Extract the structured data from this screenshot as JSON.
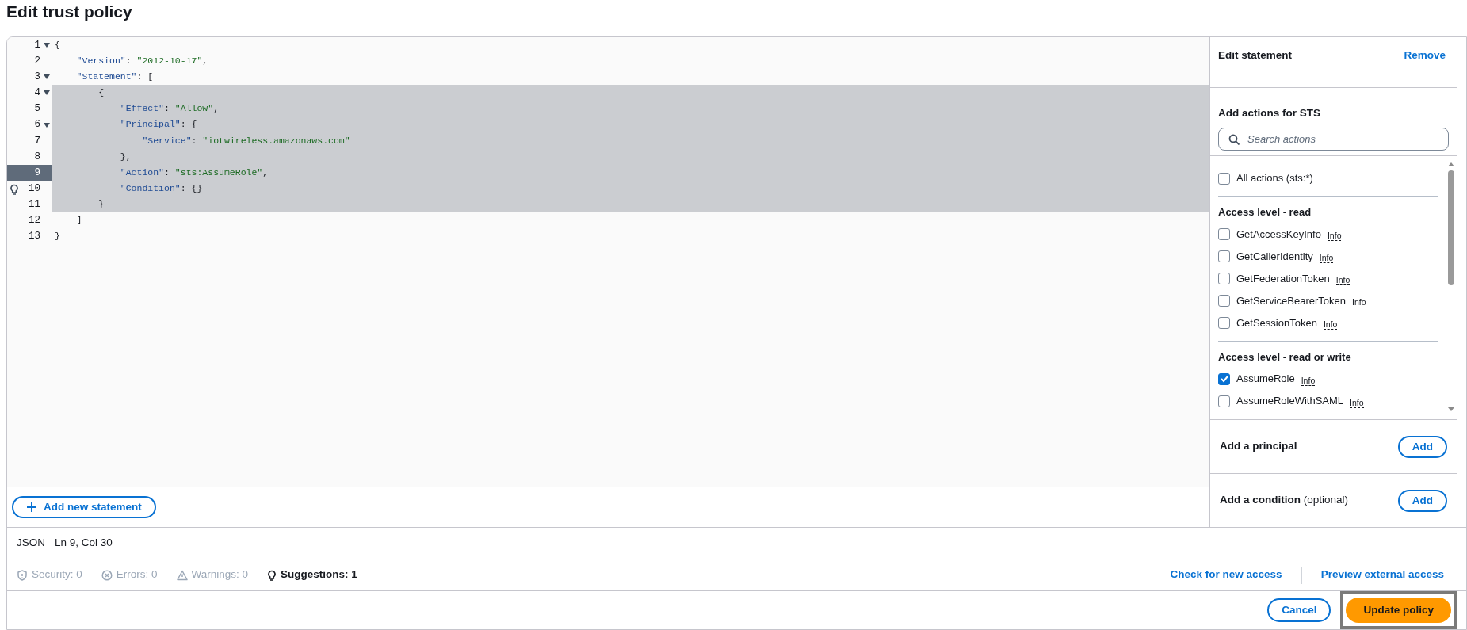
{
  "title": "Edit trust policy",
  "editor": {
    "lines": [
      {
        "number": "1",
        "fold": true,
        "selected": false,
        "current": false,
        "hint": false,
        "tokens": [
          {
            "kind": "punct",
            "text": "{"
          }
        ]
      },
      {
        "number": "2",
        "fold": false,
        "selected": false,
        "current": false,
        "hint": false,
        "tokens": [
          {
            "kind": "key",
            "text": "    \"Version\""
          },
          {
            "kind": "punct",
            "text": ": "
          },
          {
            "kind": "string",
            "text": "\"2012-10-17\""
          },
          {
            "kind": "punct",
            "text": ","
          }
        ]
      },
      {
        "number": "3",
        "fold": true,
        "selected": false,
        "current": false,
        "hint": false,
        "tokens": [
          {
            "kind": "key",
            "text": "    \"Statement\""
          },
          {
            "kind": "punct",
            "text": ": ["
          }
        ]
      },
      {
        "number": "4",
        "fold": true,
        "selected": true,
        "current": false,
        "hint": false,
        "tokens": [
          {
            "kind": "punct",
            "text": "        {"
          }
        ]
      },
      {
        "number": "5",
        "fold": false,
        "selected": true,
        "current": false,
        "hint": false,
        "tokens": [
          {
            "kind": "key",
            "text": "            \"Effect\""
          },
          {
            "kind": "punct",
            "text": ": "
          },
          {
            "kind": "string",
            "text": "\"Allow\""
          },
          {
            "kind": "punct",
            "text": ","
          }
        ]
      },
      {
        "number": "6",
        "fold": true,
        "selected": true,
        "current": false,
        "hint": false,
        "tokens": [
          {
            "kind": "key",
            "text": "            \"Principal\""
          },
          {
            "kind": "punct",
            "text": ": {"
          }
        ]
      },
      {
        "number": "7",
        "fold": false,
        "selected": true,
        "current": false,
        "hint": false,
        "tokens": [
          {
            "kind": "key",
            "text": "                \"Service\""
          },
          {
            "kind": "punct",
            "text": ": "
          },
          {
            "kind": "string",
            "text": "\"iotwireless.amazonaws.com\""
          }
        ]
      },
      {
        "number": "8",
        "fold": false,
        "selected": true,
        "current": false,
        "hint": false,
        "tokens": [
          {
            "kind": "punct",
            "text": "            },"
          }
        ]
      },
      {
        "number": "9",
        "fold": false,
        "selected": true,
        "current": true,
        "hint": false,
        "tokens": [
          {
            "kind": "key",
            "text": "            \"Action\""
          },
          {
            "kind": "punct",
            "text": ": "
          },
          {
            "kind": "string",
            "text": "\"sts:AssumeRole\""
          },
          {
            "kind": "punct",
            "text": ","
          }
        ]
      },
      {
        "number": "10",
        "fold": false,
        "selected": true,
        "current": false,
        "hint": true,
        "tokens": [
          {
            "kind": "key",
            "text": "            \"Condition\""
          },
          {
            "kind": "punct",
            "text": ": {}"
          }
        ]
      },
      {
        "number": "11",
        "fold": false,
        "selected": true,
        "current": false,
        "hint": false,
        "tokens": [
          {
            "kind": "punct",
            "text": "        }"
          }
        ]
      },
      {
        "number": "12",
        "fold": false,
        "selected": false,
        "current": false,
        "hint": false,
        "tokens": [
          {
            "kind": "punct",
            "text": "    ]"
          }
        ]
      },
      {
        "number": "13",
        "fold": false,
        "selected": false,
        "current": false,
        "hint": false,
        "tokens": [
          {
            "kind": "punct",
            "text": "}"
          }
        ]
      }
    ],
    "add_statement_button": "Add new statement"
  },
  "side_panel": {
    "heading": "Edit statement",
    "remove_link": "Remove",
    "actions_heading": "Add actions for STS",
    "search": {
      "placeholder": "Search actions"
    },
    "all_actions": {
      "label": "All actions (sts:*)",
      "checked": false
    },
    "groups": [
      {
        "heading": "Access level - read",
        "items": [
          {
            "label": "GetAccessKeyInfo",
            "info": "Info",
            "checked": false
          },
          {
            "label": "GetCallerIdentity",
            "info": "Info",
            "checked": false
          },
          {
            "label": "GetFederationToken",
            "info": "Info",
            "checked": false
          },
          {
            "label": "GetServiceBearerToken",
            "info": "Info",
            "checked": false
          },
          {
            "label": "GetSessionToken",
            "info": "Info",
            "checked": false
          }
        ]
      },
      {
        "heading": "Access level - read or write",
        "items": [
          {
            "label": "AssumeRole",
            "info": "Info",
            "checked": true
          },
          {
            "label": "AssumeRoleWithSAML",
            "info": "Info",
            "checked": false
          }
        ]
      }
    ],
    "sections": [
      {
        "label": "Add a principal",
        "button": "Add"
      },
      {
        "label": "Add a condition",
        "note": "(optional)",
        "button": "Add"
      }
    ]
  },
  "status_bar": {
    "language": "JSON",
    "position": "Ln 9, Col 30"
  },
  "diagnostics": [
    {
      "kind": "security",
      "label": "Security: 0",
      "active": false
    },
    {
      "kind": "errors",
      "label": "Errors: 0",
      "active": false
    },
    {
      "kind": "warnings",
      "label": "Warnings: 0",
      "active": false
    },
    {
      "kind": "suggestions",
      "label": "Suggestions: 1",
      "active": true
    }
  ],
  "links": [
    "Check for new access",
    "Preview external access"
  ],
  "footer": {
    "cancel": "Cancel",
    "submit": "Update policy"
  }
}
